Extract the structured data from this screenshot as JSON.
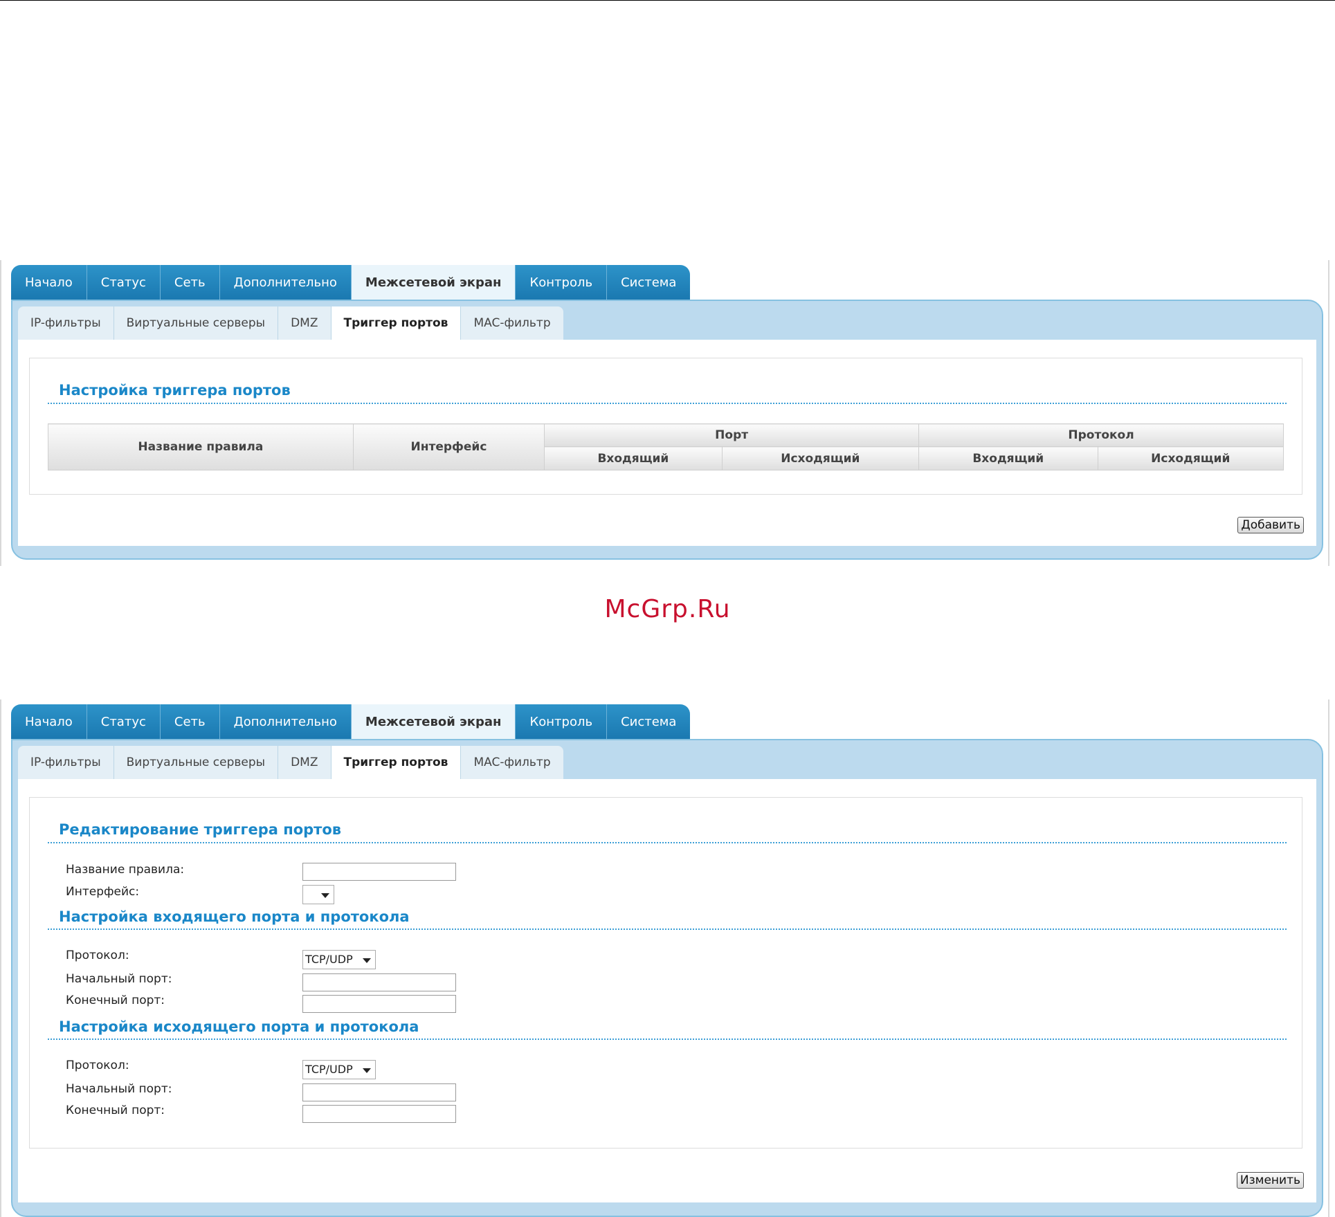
{
  "main_tabs": [
    "Начало",
    "Статус",
    "Сеть",
    "Дополнительно",
    "Межсетевой экран",
    "Контроль",
    "Система"
  ],
  "sub_tabs": [
    "IP-фильтры",
    "Виртуальные серверы",
    "DMZ",
    "Триггер портов",
    "MAC-фильтр"
  ],
  "active_main_tab": "Межсетевой экран",
  "active_sub_tab": "Триггер портов",
  "screen1": {
    "section_title": "Настройка триггера портов",
    "table": {
      "col_rule_name": "Название правила",
      "col_interface": "Интерфейс",
      "col_port": "Порт",
      "col_protocol": "Протокол",
      "sub_incoming": "Входящий",
      "sub_outgoing": "Исходящий"
    },
    "add_button": "Добавить"
  },
  "watermark": "McGrp.Ru",
  "screen2": {
    "section_title": "Редактирование триггера портов",
    "rule_name_label": "Название правила:",
    "rule_name_value": "",
    "interface_label": "Интерфейс:",
    "interface_value": "",
    "incoming_section_title": "Настройка входящего порта и протокола",
    "incoming": {
      "protocol_label": "Протокол:",
      "protocol_value": "TCP/UDP",
      "start_port_label": "Начальный порт:",
      "start_port_value": "",
      "end_port_label": "Конечный порт:",
      "end_port_value": ""
    },
    "outgoing_section_title": "Настройка исходящего порта и протокола",
    "outgoing": {
      "protocol_label": "Протокол:",
      "protocol_value": "TCP/UDP",
      "start_port_label": "Начальный порт:",
      "start_port_value": "",
      "end_port_label": "Конечный порт:",
      "end_port_value": ""
    },
    "change_button": "Изменить"
  }
}
